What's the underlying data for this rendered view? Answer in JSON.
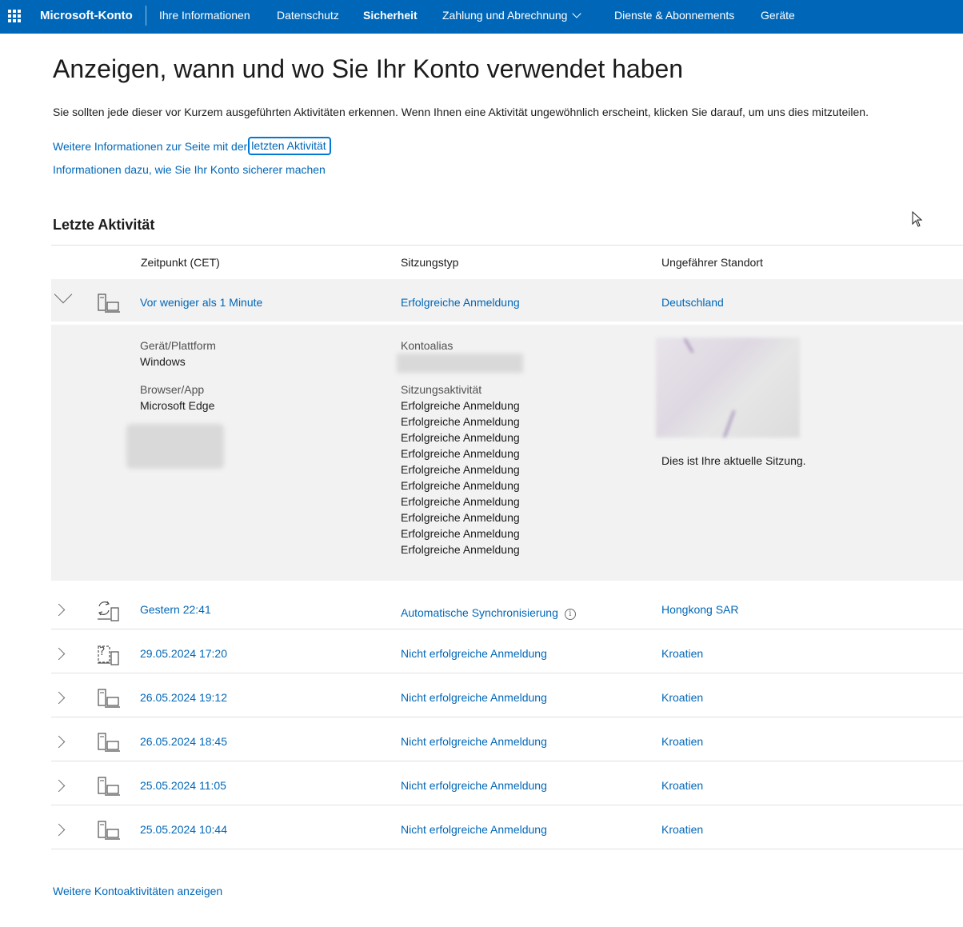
{
  "nav": {
    "brand": "Microsoft-Konto",
    "items": [
      {
        "label": "Ihre Informationen"
      },
      {
        "label": "Datenschutz"
      },
      {
        "label": "Sicherheit"
      },
      {
        "label": "Zahlung und Abrechnung"
      },
      {
        "label": "Dienste & Abonnements"
      },
      {
        "label": "Geräte"
      }
    ],
    "active": "Sicherheit",
    "colors": {
      "bar": "#0067b8",
      "link": "#0067b8",
      "focus": "#0078d4",
      "row_bg": "#f2f2f2"
    }
  },
  "header": {
    "title": "Anzeigen, wann und wo Sie Ihr Konto verwendet haben",
    "intro": "Sie sollten jede dieser vor Kurzem ausgeführten Aktivitäten erkennen. Wenn Ihnen eine Aktivität ungewöhnlich erscheint, klicken Sie darauf, um uns dies mitzuteilen.",
    "link1_prefix": "Weitere Informationen zur Seite mit der",
    "link1_focus": "letzten Aktivität",
    "link2": "Informationen dazu, wie Sie Ihr Konto sicherer machen"
  },
  "activity": {
    "section_title": "Letzte Aktivität",
    "columns": [
      "Zeitpunkt (CET)",
      "Sitzungstyp",
      "Ungefährer Standort"
    ],
    "expanded": {
      "time": "Vor weniger als 1 Minute",
      "type": "Erfolgreiche Anmeldung",
      "location": "Deutschland",
      "device_label": "Gerät/Plattform",
      "device_value": "Windows",
      "browser_label": "Browser/App",
      "browser_value": "Microsoft Edge",
      "alias_label": "Kontoalias",
      "session_label": "Sitzungsaktivität",
      "session_items": [
        "Erfolgreiche Anmeldung",
        "Erfolgreiche Anmeldung",
        "Erfolgreiche Anmeldung",
        "Erfolgreiche Anmeldung",
        "Erfolgreiche Anmeldung",
        "Erfolgreiche Anmeldung",
        "Erfolgreiche Anmeldung",
        "Erfolgreiche Anmeldung",
        "Erfolgreiche Anmeldung",
        "Erfolgreiche Anmeldung"
      ],
      "current_session_note": "Dies ist Ihre aktuelle Sitzung."
    },
    "rows": [
      {
        "time": "Gestern 22:41",
        "type": "Automatische Synchronisierung",
        "location": "Hongkong SAR",
        "icon": "sync-device-icon",
        "info_icon": "i"
      },
      {
        "time": "29.05.2024 17:20",
        "type": "Nicht erfolgreiche Anmeldung",
        "location": "Kroatien",
        "icon": "unknown-device-icon"
      },
      {
        "time": "26.05.2024 19:12",
        "type": "Nicht erfolgreiche Anmeldung",
        "location": "Kroatien",
        "icon": "computer-icon"
      },
      {
        "time": "26.05.2024 18:45",
        "type": "Nicht erfolgreiche Anmeldung",
        "location": "Kroatien",
        "icon": "computer-icon"
      },
      {
        "time": "25.05.2024 11:05",
        "type": "Nicht erfolgreiche Anmeldung",
        "location": "Kroatien",
        "icon": "computer-icon"
      },
      {
        "time": "25.05.2024 10:44",
        "type": "Nicht erfolgreiche Anmeldung",
        "location": "Kroatien",
        "icon": "computer-icon"
      }
    ],
    "more_link": "Weitere Kontoaktivitäten anzeigen"
  }
}
